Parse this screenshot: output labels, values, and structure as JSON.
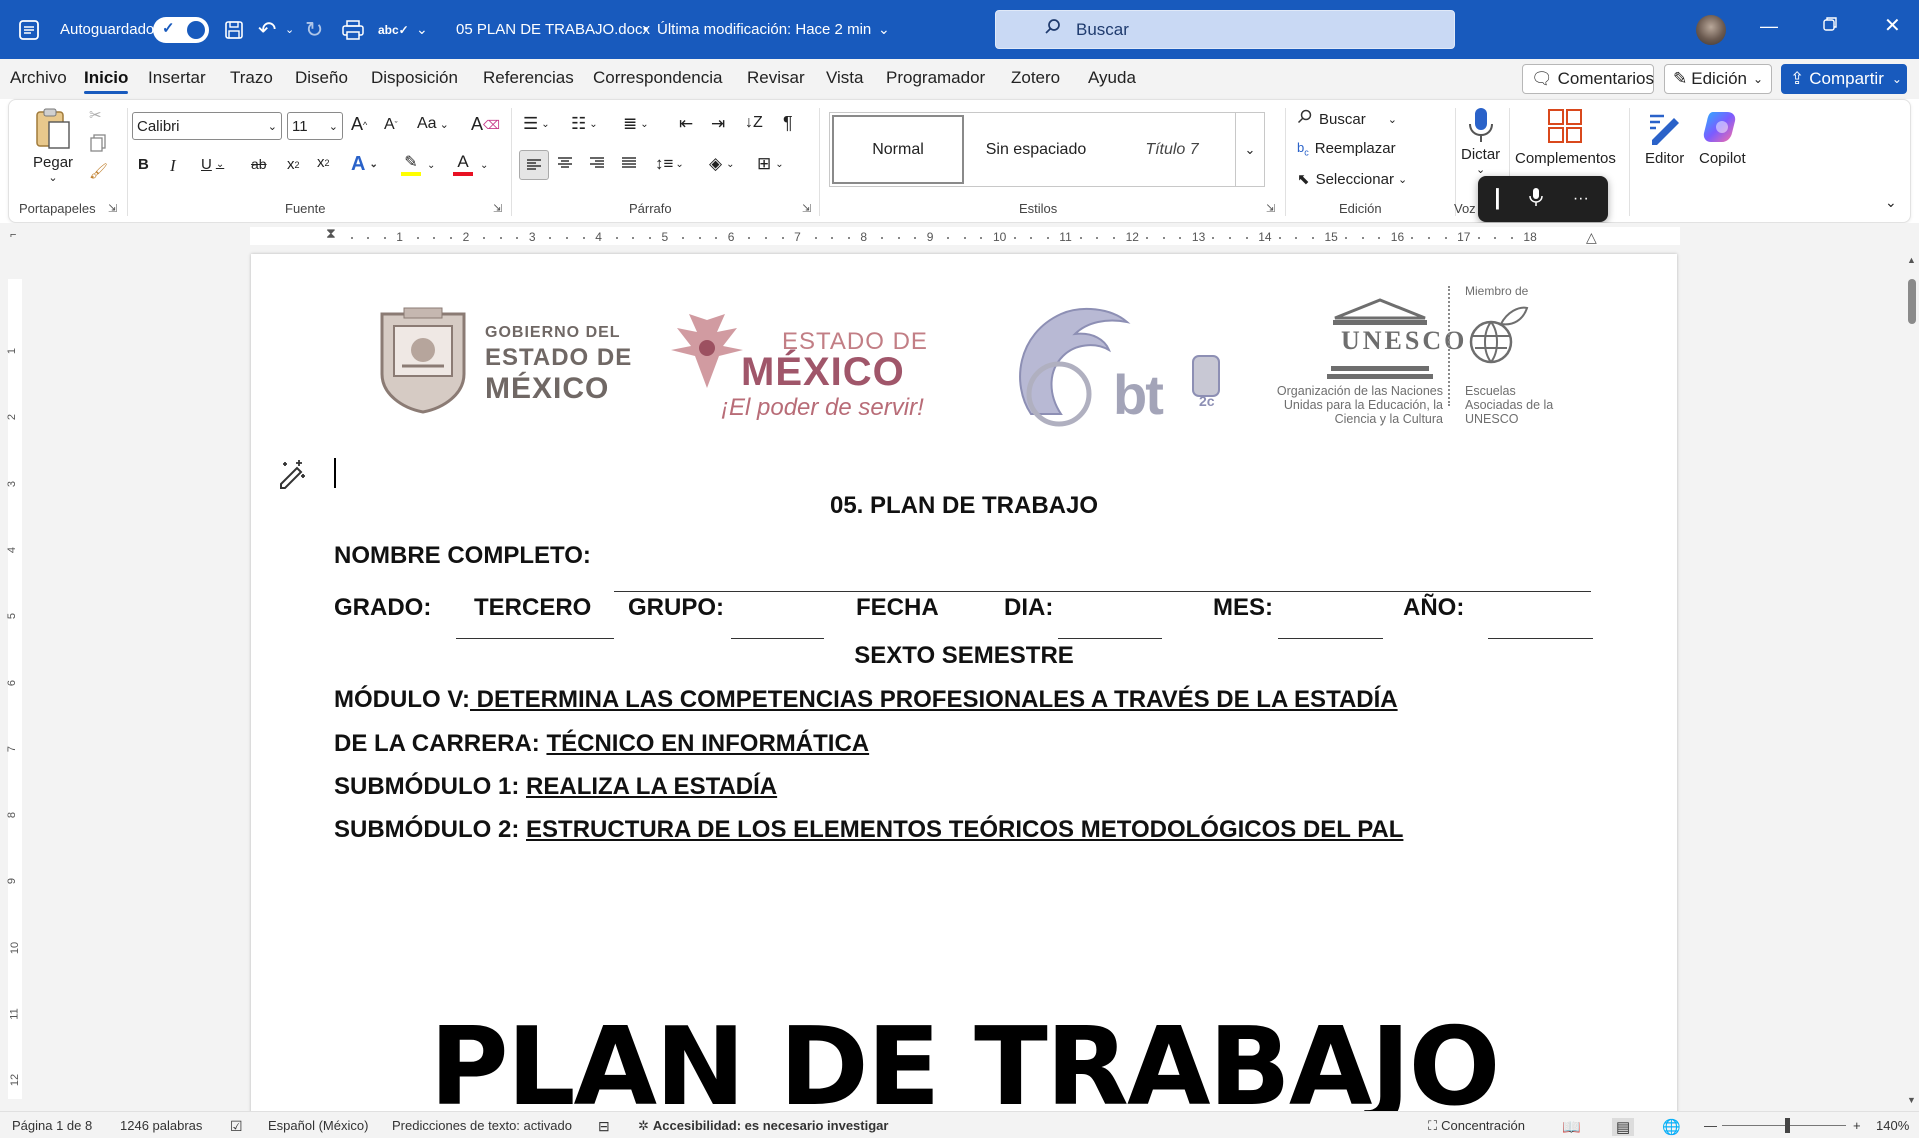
{
  "titlebar": {
    "autosave_label": "Autoguardado",
    "doc_title": "05 PLAN DE TRABAJO.docx",
    "bullet": "•",
    "modified": "Última modificación: Hace 2 min",
    "search_placeholder": "Buscar"
  },
  "menu": {
    "tabs": [
      "Archivo",
      "Inicio",
      "Insertar",
      "Trazo",
      "Diseño",
      "Disposición",
      "Referencias",
      "Correspondencia",
      "Revisar",
      "Vista",
      "Programador",
      "Zotero",
      "Ayuda"
    ],
    "comments": "Comentarios",
    "editing": "Edición",
    "share": "Compartir"
  },
  "ribbon": {
    "clipboard": {
      "paste": "Pegar",
      "label": "Portapapeles"
    },
    "font": {
      "name": "Calibri",
      "size": "11",
      "label": "Fuente",
      "case": "Aa"
    },
    "paragraph": {
      "label": "Párrafo"
    },
    "styles": {
      "items": [
        "Normal",
        "Sin espaciado",
        "Título 7"
      ],
      "label": "Estilos"
    },
    "editing": {
      "find": "Buscar",
      "replace": "Reemplazar",
      "select": "Seleccionar",
      "label": "Edición"
    },
    "voice": {
      "dictate": "Dictar",
      "label": "Voz"
    },
    "addins": {
      "label": "Complementos"
    },
    "editor": "Editor",
    "copilot": "Copilot"
  },
  "ruler": {
    "h_numbers": [
      "1",
      "2",
      "3",
      "4",
      "5",
      "6",
      "7",
      "8",
      "9",
      "10",
      "11",
      "12",
      "13",
      "14",
      "15",
      "16",
      "17",
      "18"
    ],
    "v_numbers": [
      "1",
      "2",
      "3",
      "4",
      "5",
      "6",
      "7",
      "8",
      "9",
      "10",
      "11",
      "12"
    ]
  },
  "logos": {
    "gob_line1": "GOBIERNO DEL",
    "gob_line2": "ESTADO DE",
    "gob_line3": "MÉXICO",
    "edo_line1": "ESTADO DE",
    "edo_line2": "MÉXICO",
    "edo_slogan": "¡El poder de servir!",
    "cbt": "bt",
    "unesco": "UNESCO",
    "unesco_member": "Miembro de",
    "unesco_org": "Organización de las Naciones Unidas para la Educación, la Ciencia y la Cultura",
    "unesco_schools": "Escuelas Asociadas de la UNESCO"
  },
  "document": {
    "title": "05. PLAN DE TRABAJO",
    "name_label": "NOMBRE COMPLETO:",
    "grado_label": "GRADO:",
    "grado_value": "TERCERO",
    "grupo_label": "GRUPO:",
    "fecha_label": "FECHA",
    "dia_label": "DIA:",
    "mes_label": "MES:",
    "anio_label": "AÑO:",
    "semestre": "SEXTO SEMESTRE",
    "modulo_label": "MÓDULO V:",
    "modulo_value": " DETERMINA LAS COMPETENCIAS PROFESIONALES A TRAVÉS DE LA ESTADÍA",
    "carrera_label": "DE LA CARRERA:",
    "carrera_value": "TÉCNICO EN INFORMÁTICA",
    "sub1_label": "SUBMÓDULO 1:",
    "sub1_value": "REALIZA LA ESTADÍA",
    "sub2_label": "SUBMÓDULO 2:",
    "sub2_value": "ESTRUCTURA DE LOS ELEMENTOS TEÓRICOS METODOLÓGICOS DEL PAL",
    "big_title": "PLAN DE TRABAJO"
  },
  "status": {
    "page": "Página 1 de 8",
    "words": "1246 palabras",
    "language": "Español (México)",
    "predictions": "Predicciones de texto: activado",
    "accessibility": "Accesibilidad: es necesario investigar",
    "focus": "Concentración",
    "zoom": "140%"
  },
  "colors": {
    "brand": "#185abd",
    "copilot": "#7b5cff",
    "font_red": "#e81123",
    "highlight": "#ffff00"
  }
}
